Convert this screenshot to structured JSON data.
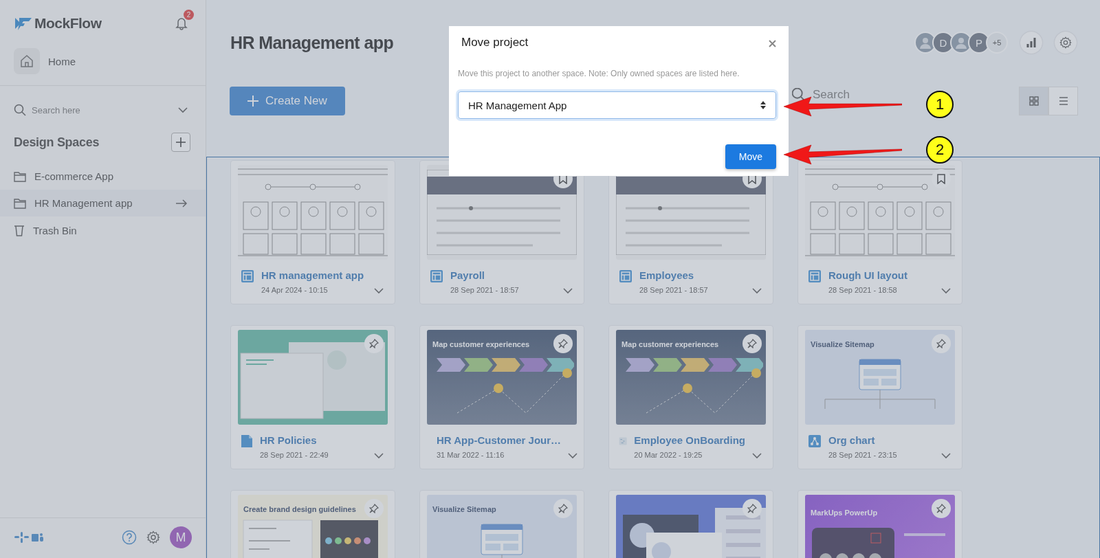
{
  "sidebar": {
    "logo": "MockFlow",
    "notification_count": "2",
    "home": "Home",
    "search": {
      "placeholder": "Search here"
    },
    "section_title": "Design Spaces",
    "spaces": [
      {
        "label": "E-commerce App",
        "kind": "folder",
        "selected": false
      },
      {
        "label": "HR Management app",
        "kind": "folder",
        "selected": true
      },
      {
        "label": "Trash Bin",
        "kind": "trash",
        "selected": false
      }
    ],
    "avatar": "M"
  },
  "header": {
    "title": "HR Management app",
    "collaborators": [
      {
        "kind": "photo"
      },
      {
        "kind": "letter",
        "initial": "D"
      },
      {
        "kind": "photo"
      },
      {
        "kind": "letter",
        "initial": "P"
      }
    ],
    "more": "+5"
  },
  "toolbar": {
    "create_button": "Create New",
    "search": {
      "placeholder": "Search"
    },
    "views": [
      {
        "kind": "grid",
        "selected": true
      },
      {
        "kind": "list",
        "selected": false
      }
    ]
  },
  "projects": [
    {
      "kind": "wireframe",
      "name": "HR management app",
      "date": "24 Apr 2024 - 10:15",
      "thumbnail": {
        "kind": "wireframe"
      }
    },
    {
      "kind": "wireframe",
      "name": "Payroll",
      "date": "28 Sep 2021 - 18:57",
      "bookmarked": true,
      "thumbnail": {
        "kind": "app"
      }
    },
    {
      "kind": "wireframe",
      "name": "Employees",
      "date": "28 Sep 2021 - 18:57",
      "bookmarked": true,
      "thumbnail": {
        "kind": "app"
      }
    },
    {
      "kind": "wireframe",
      "name": "Rough UI layout",
      "date": "28 Sep 2021 - 18:58",
      "bookmarked": true,
      "thumbnail": {
        "kind": "wireframe"
      }
    },
    {
      "kind": "document",
      "name": "HR Policies",
      "date": "28 Sep 2021 - 22:49",
      "template": true,
      "thumbnail": {
        "kind": "policy"
      }
    },
    {
      "kind": "journey",
      "name": "HR App-Customer Jour…",
      "date": "31 Mar 2022 - 11:16",
      "template": true,
      "thumbnail": {
        "kind": "journey",
        "heading": "Map customer experiences"
      }
    },
    {
      "kind": "journey",
      "name": "Employee OnBoarding",
      "date": "20 Mar 2022 - 19:25",
      "template": true,
      "thumbnail": {
        "kind": "journey",
        "heading": "Map customer experiences"
      }
    },
    {
      "kind": "orgchart",
      "name": "Org chart",
      "date": "28 Sep 2021 - 23:15",
      "template": true,
      "thumbnail": {
        "kind": "sitemap",
        "heading": "Visualize Sitemap"
      }
    },
    {
      "template": true,
      "thumbnail": {
        "kind": "brand",
        "heading": "Create brand design guidelines"
      }
    },
    {
      "template": true,
      "thumbnail": {
        "kind": "sitemap",
        "heading": "Visualize Sitemap"
      }
    },
    {
      "template": true,
      "thumbnail": {
        "kind": "profile"
      }
    },
    {
      "template": true,
      "thumbnail": {
        "kind": "markups",
        "heading": "MarkUps PowerUp"
      }
    }
  ],
  "dialog": {
    "title": "Move project",
    "note": "Move this project to another space. Note: Only owned spaces are listed here.",
    "space_select": "HR Management App",
    "move_button": "Move"
  },
  "callouts": [
    {
      "number": "1"
    },
    {
      "number": "2"
    }
  ]
}
